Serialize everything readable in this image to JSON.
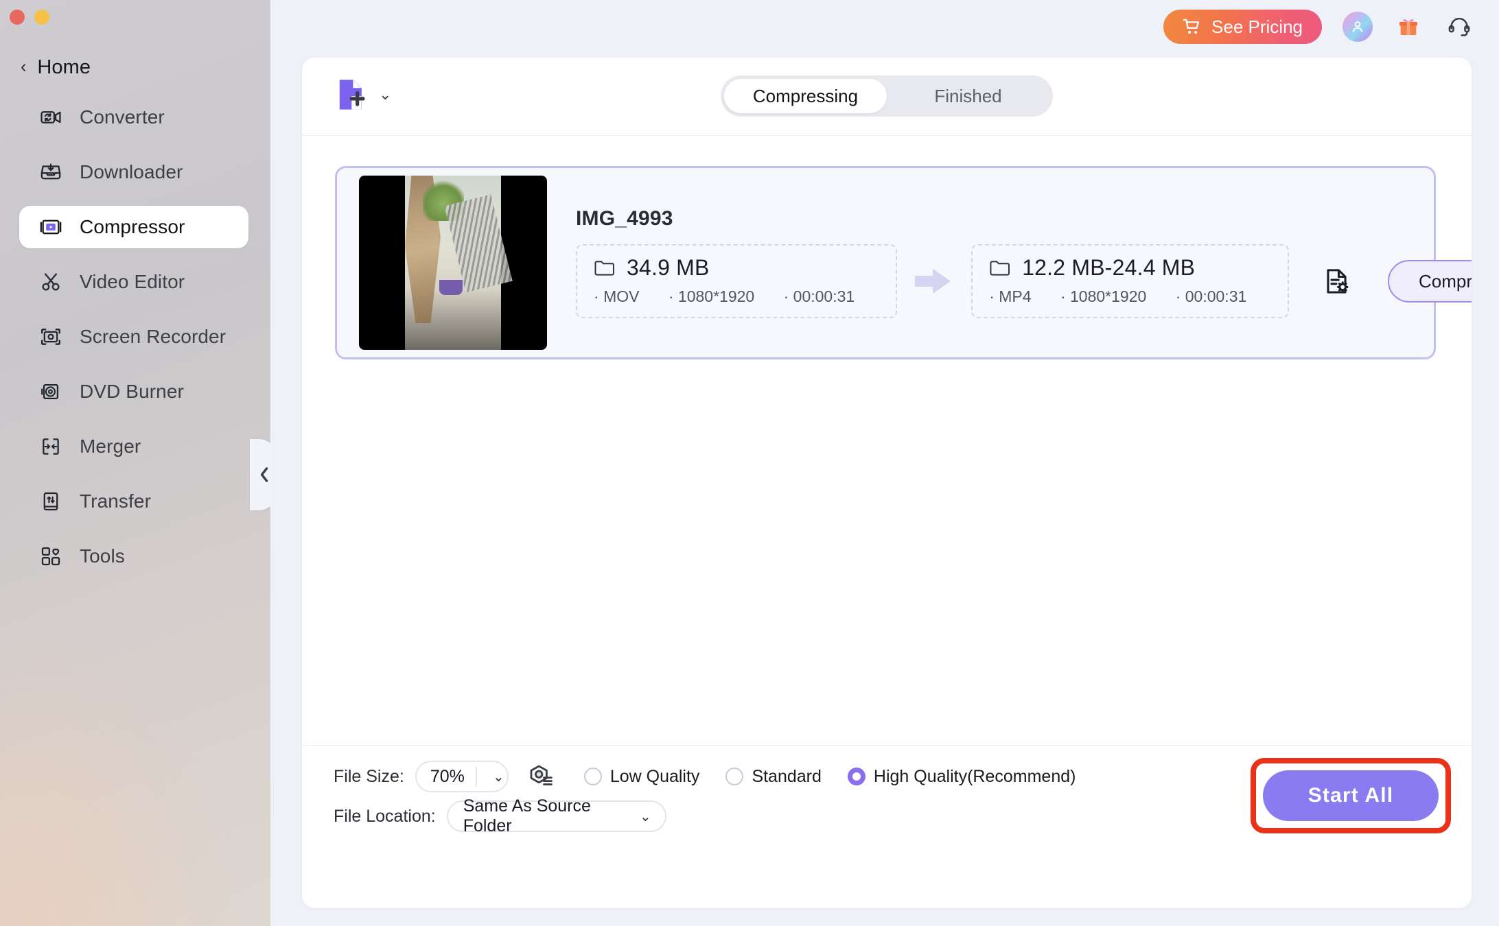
{
  "window": {
    "traffic_lights": [
      "close",
      "minimize"
    ]
  },
  "sidebar": {
    "back_label": "Home",
    "back_icon": "chevron-left-icon",
    "collapse_icon": "chevron-left-icon",
    "items": [
      {
        "label": "Converter",
        "icon": "video-convert-icon",
        "active": false
      },
      {
        "label": "Downloader",
        "icon": "download-tray-icon",
        "active": false
      },
      {
        "label": "Compressor",
        "icon": "video-compress-icon",
        "active": true
      },
      {
        "label": "Video Editor",
        "icon": "scissors-icon",
        "active": false
      },
      {
        "label": "Screen Recorder",
        "icon": "screen-record-icon",
        "active": false
      },
      {
        "label": "DVD Burner",
        "icon": "disc-icon",
        "active": false
      },
      {
        "label": "Merger",
        "icon": "merge-arrows-icon",
        "active": false
      },
      {
        "label": "Transfer",
        "icon": "transfer-phone-icon",
        "active": false
      },
      {
        "label": "Tools",
        "icon": "tools-grid-icon",
        "active": false
      }
    ]
  },
  "header": {
    "pricing_label": "See Pricing",
    "pricing_icon": "shopping-cart-icon",
    "avatar_icon": "user-avatar-icon",
    "gift_icon": "gift-icon",
    "support_icon": "headset-icon",
    "pricing_gradient_from": "#f0893f",
    "pricing_gradient_to": "#ee5a7e"
  },
  "panel": {
    "add_file_icon": "add-file-icon",
    "add_file_caret": "⌄",
    "tabs": [
      {
        "label": "Compressing",
        "active": true
      },
      {
        "label": "Finished",
        "active": false
      }
    ]
  },
  "file_card": {
    "name": "IMG_4993",
    "accent_border": "#c3c0ef",
    "source": {
      "folder_icon": "folder-icon",
      "size": "34.9 MB",
      "format": "MOV",
      "resolution": "1080*1920",
      "duration": "00:00:31"
    },
    "arrow_icon": "arrow-right-icon",
    "output": {
      "folder_icon": "folder-icon",
      "size": "12.2 MB-24.4 MB",
      "format": "MP4",
      "resolution": "1080*1920",
      "duration": "00:00:31"
    },
    "settings_icon": "file-settings-icon",
    "compress_label": "Compress"
  },
  "footer": {
    "file_size_label": "File Size:",
    "file_size_value": "70%",
    "file_size_caret": "⌄",
    "preview_icon": "quality-preview-icon",
    "quality_options": [
      {
        "label": "Low Quality",
        "selected": false
      },
      {
        "label": "Standard",
        "selected": false
      },
      {
        "label": "High Quality(Recommend)",
        "selected": true
      }
    ],
    "file_location_label": "File Location:",
    "file_location_value": "Same As Source Folder",
    "file_location_caret": "⌄",
    "start_all_label": "Start  All",
    "start_all_color": "#8b7bf0",
    "highlight_color": "#e8321a"
  }
}
